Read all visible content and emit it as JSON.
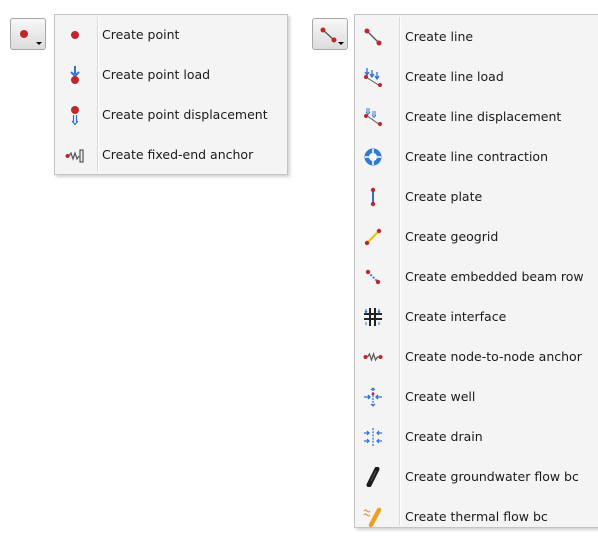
{
  "left_menu": {
    "button_icon": "red-point-icon",
    "items": [
      {
        "label": "Create point",
        "icon": "point-icon"
      },
      {
        "label": "Create point load",
        "icon": "point-load-icon"
      },
      {
        "label": "Create point displacement",
        "icon": "point-displacement-icon"
      },
      {
        "label": "Create fixed-end anchor",
        "icon": "fixed-end-anchor-icon"
      }
    ]
  },
  "right_menu": {
    "button_icon": "line-icon",
    "items": [
      {
        "label": "Create line",
        "icon": "line-icon"
      },
      {
        "label": "Create line load",
        "icon": "line-load-icon"
      },
      {
        "label": "Create line displacement",
        "icon": "line-displacement-icon"
      },
      {
        "label": "Create line contraction",
        "icon": "line-contraction-icon"
      },
      {
        "label": "Create plate",
        "icon": "plate-icon"
      },
      {
        "label": "Create geogrid",
        "icon": "geogrid-icon"
      },
      {
        "label": "Create embedded beam row",
        "icon": "embedded-beam-row-icon"
      },
      {
        "label": "Create interface",
        "icon": "interface-icon"
      },
      {
        "label": "Create node-to-node anchor",
        "icon": "node-to-node-anchor-icon"
      },
      {
        "label": "Create well",
        "icon": "well-icon"
      },
      {
        "label": "Create drain",
        "icon": "drain-icon"
      },
      {
        "label": "Create groundwater flow bc",
        "icon": "groundwater-flow-bc-icon"
      },
      {
        "label": "Create thermal flow bc",
        "icon": "thermal-flow-bc-icon"
      }
    ]
  },
  "colors": {
    "point_red": "#c0262d",
    "load_blue": "#2f6fd6",
    "menu_bg": "#f4f4f4",
    "menu_border": "#c4c4c4"
  }
}
